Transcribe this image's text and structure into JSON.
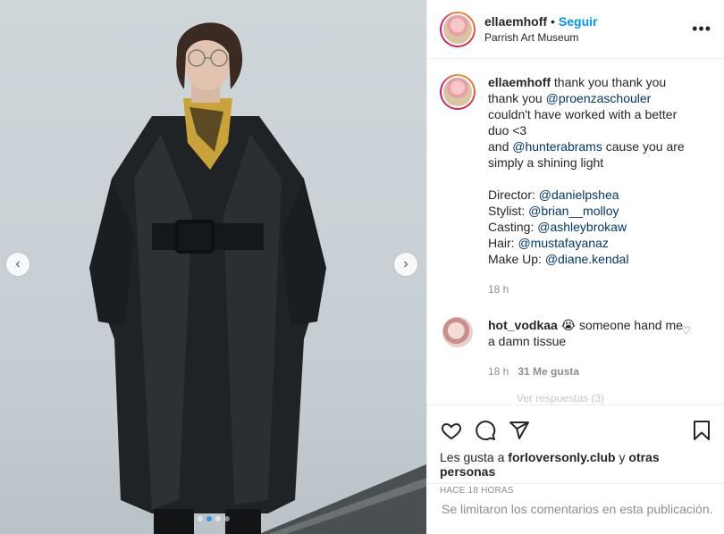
{
  "post": {
    "username": "ellaemhoff",
    "follow_separator": "•",
    "follow_label": "Seguir",
    "location": "Parrish Art Museum",
    "more_label": "•••"
  },
  "caption": {
    "username": "ellaemhoff",
    "text_1": "thank you thank you thank you",
    "mention_1": "@proenzaschouler",
    "text_2": "couldn't have worked with a better duo <3",
    "text_3": "and",
    "mention_2": "@hunterabrams",
    "text_4": "cause you are simply a shining light",
    "credits": [
      {
        "role": "Director:",
        "handle": "@danielpshea"
      },
      {
        "role": "Stylist:",
        "handle": "@brian__molloy"
      },
      {
        "role": "Casting:",
        "handle": "@ashleybrokaw"
      },
      {
        "role": "Hair:",
        "handle": "@mustafayanaz"
      },
      {
        "role": "Make Up:",
        "handle": "@diane.kendal"
      }
    ],
    "time": "18 h"
  },
  "comment": {
    "username": "hot_vodkaa",
    "emoji": "😭",
    "text": "someone hand me a damn tissue",
    "time": "18 h",
    "likes": "31 Me gusta"
  },
  "hidden_fragment": "Ver respuestas (3)",
  "likes": {
    "prefix": "Les gusta a",
    "user": "forloversonly.club",
    "joiner": "y",
    "others": "otras personas"
  },
  "timestamp": "HACE 18 HORAS",
  "comments_limited": "Se limitaron los comentarios en esta publicación.",
  "carousel": {
    "total": 4,
    "active": 1
  },
  "colors": {
    "accent": "#0095f6",
    "mention": "#00376b",
    "muted": "#8e8e8e"
  }
}
